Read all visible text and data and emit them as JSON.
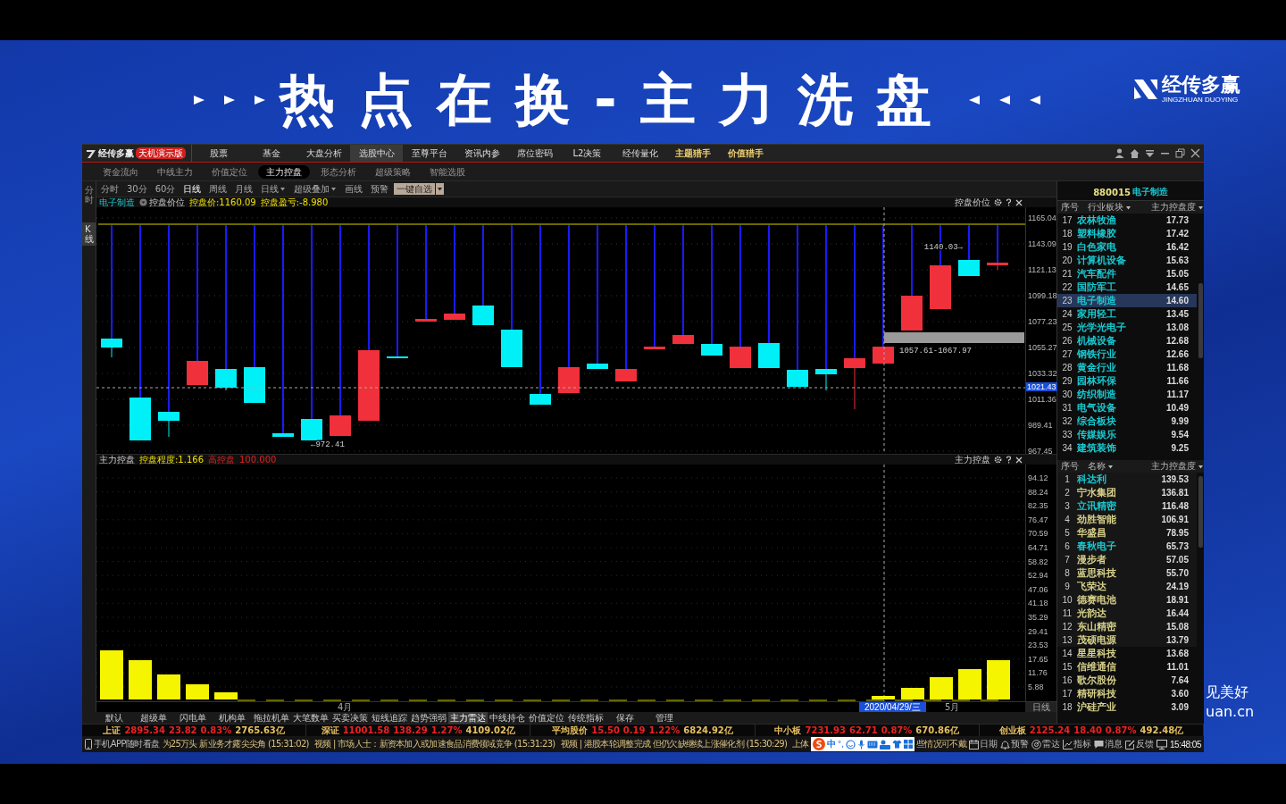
{
  "banner": {
    "title": "热点在换-主力洗盘",
    "logo": {
      "name": "经传多赢",
      "subtitle": "JINGZHUAN DUOYING"
    }
  },
  "backdrop_text": [
    "见美好",
    "uan.cn"
  ],
  "window": {
    "app_name": "经传多赢",
    "edition": "天机演示版",
    "menu": [
      {
        "label": "股票",
        "selected": false,
        "highlighted": false
      },
      {
        "label": "基金",
        "selected": false,
        "highlighted": false
      },
      {
        "label": "大盘分析",
        "selected": false,
        "highlighted": false
      },
      {
        "label": "选股中心",
        "selected": true,
        "highlighted": false
      },
      {
        "label": "至尊平台",
        "selected": false,
        "highlighted": false
      },
      {
        "label": "资讯内参",
        "selected": false,
        "highlighted": false
      },
      {
        "label": "席位密码",
        "selected": false,
        "highlighted": false
      },
      {
        "label": "L2决策",
        "selected": false,
        "highlighted": false
      },
      {
        "label": "经传量化",
        "selected": false,
        "highlighted": false
      },
      {
        "label": "主题猎手",
        "selected": false,
        "highlighted": true
      },
      {
        "label": "价值猎手",
        "selected": false,
        "highlighted": true
      }
    ]
  },
  "subtabs": [
    {
      "label": "资金流向",
      "selected": false
    },
    {
      "label": "中线主力",
      "selected": false
    },
    {
      "label": "价值定位",
      "selected": false
    },
    {
      "label": "主力控盘",
      "selected": true
    },
    {
      "label": "形态分析",
      "selected": false
    },
    {
      "label": "超级策略",
      "selected": false
    },
    {
      "label": "智能选股",
      "selected": false
    }
  ],
  "side_tabs": [
    {
      "label": "分时",
      "selected": false
    },
    {
      "label": "K线",
      "selected": true
    }
  ],
  "toolbar": [
    {
      "kind": "tab",
      "label": "分时",
      "selected": false
    },
    {
      "kind": "tab",
      "label": "30分",
      "selected": false
    },
    {
      "kind": "tab",
      "label": "60分",
      "selected": false
    },
    {
      "kind": "tab",
      "label": "日线",
      "selected": true
    },
    {
      "kind": "tab",
      "label": "周线",
      "selected": false
    },
    {
      "kind": "tab",
      "label": "月线",
      "selected": false
    },
    {
      "kind": "dropdown",
      "label": "日线"
    },
    {
      "kind": "dropdown",
      "label": "超级叠加"
    },
    {
      "kind": "button",
      "label": "画线"
    },
    {
      "kind": "button",
      "label": "预警"
    },
    {
      "kind": "split",
      "label": "一键自选"
    }
  ],
  "upper_panel": {
    "name": "电子制造",
    "toggle": "控盘价位",
    "price": "控盘价:1160.09",
    "pnl": "控盘盈亏:-8.980",
    "title": "控盘价位",
    "y_labels": [
      "1165.04",
      "1143.09",
      "1121.13",
      "1099.18",
      "1077.23",
      "1055.27",
      "1033.32",
      "1011.36",
      "989.41",
      "967.45"
    ],
    "current": "1021.43",
    "annotations": [
      "1140.03→",
      "←972.41",
      "1057.61-1067.97"
    ]
  },
  "lower_panel": {
    "name": "主力控盘",
    "degree": "控盘程度:1.166",
    "high_label": "高控盘",
    "high_value": "100.000",
    "title": "主力控盘",
    "y_labels": [
      "94.12",
      "88.24",
      "82.35",
      "76.47",
      "70.59",
      "64.71",
      "58.82",
      "52.94",
      "47.06",
      "41.18",
      "35.29",
      "29.41",
      "23.53",
      "17.65",
      "11.76",
      "5.88"
    ]
  },
  "date_axis": {
    "labels": [
      "4月",
      "5月"
    ],
    "cursor_date": "2020/04/29/三",
    "period": "日线"
  },
  "bottom_tabs": [
    {
      "label": "默认",
      "selected": false
    },
    {
      "label": "超级单",
      "selected": false
    },
    {
      "label": "闪电单",
      "selected": false
    },
    {
      "label": "机构单",
      "selected": false
    },
    {
      "label": "拖拉机单",
      "selected": false
    },
    {
      "label": "大笔数单",
      "selected": false
    },
    {
      "label": "买卖决策",
      "selected": false
    },
    {
      "label": "短线追踪",
      "selected": false
    },
    {
      "label": "趋势强弱",
      "selected": false
    },
    {
      "label": "主力雷达",
      "selected": true
    },
    {
      "label": "中线持仓",
      "selected": false
    },
    {
      "label": "价值定位",
      "selected": false
    },
    {
      "label": "传统指标",
      "selected": false
    },
    {
      "label": "保存",
      "selected": false
    },
    {
      "label": "管理",
      "selected": false
    }
  ],
  "right_panel": {
    "code": "880015",
    "name": "电子制造",
    "sector_columns": [
      "序号",
      "行业板块",
      "主力控盘度"
    ],
    "sectors": [
      {
        "no": "17",
        "name": "农林牧渔",
        "value": "17.73",
        "selected": false
      },
      {
        "no": "18",
        "name": "塑料橡胶",
        "value": "17.42",
        "selected": false
      },
      {
        "no": "19",
        "name": "白色家电",
        "value": "16.42",
        "selected": false
      },
      {
        "no": "20",
        "name": "计算机设备",
        "value": "15.63",
        "selected": false
      },
      {
        "no": "21",
        "name": "汽车配件",
        "value": "15.05",
        "selected": false
      },
      {
        "no": "22",
        "name": "国防军工",
        "value": "14.65",
        "selected": false
      },
      {
        "no": "23",
        "name": "电子制造",
        "value": "14.60",
        "selected": true
      },
      {
        "no": "24",
        "name": "家用轻工",
        "value": "13.45",
        "selected": false
      },
      {
        "no": "25",
        "name": "光学光电子",
        "value": "13.08",
        "selected": false
      },
      {
        "no": "26",
        "name": "机械设备",
        "value": "12.68",
        "selected": false
      },
      {
        "no": "27",
        "name": "钢铁行业",
        "value": "12.66",
        "selected": false
      },
      {
        "no": "28",
        "name": "黄金行业",
        "value": "11.68",
        "selected": false
      },
      {
        "no": "29",
        "name": "园林环保",
        "value": "11.66",
        "selected": false
      },
      {
        "no": "30",
        "name": "纺织制造",
        "value": "11.17",
        "selected": false
      },
      {
        "no": "31",
        "name": "电气设备",
        "value": "10.49",
        "selected": false
      },
      {
        "no": "32",
        "name": "综合板块",
        "value": "9.99",
        "selected": false
      },
      {
        "no": "33",
        "name": "传媒娱乐",
        "value": "9.54",
        "selected": false
      },
      {
        "no": "34",
        "name": "建筑装饰",
        "value": "9.25",
        "selected": false
      }
    ],
    "stock_columns": [
      "序号",
      "名称",
      "主力控盘度"
    ],
    "stocks": [
      {
        "no": "1",
        "name": "科达利",
        "value": "139.53",
        "color": "#19c8d0"
      },
      {
        "no": "2",
        "name": "宁水集团",
        "value": "136.81",
        "color": "#d6d08a"
      },
      {
        "no": "3",
        "name": "立讯精密",
        "value": "116.48",
        "color": "#19c8d0"
      },
      {
        "no": "4",
        "name": "劲胜智能",
        "value": "106.91",
        "color": "#d6d08a"
      },
      {
        "no": "5",
        "name": "华盛昌",
        "value": "78.95",
        "color": "#d6d08a"
      },
      {
        "no": "6",
        "name": "春秋电子",
        "value": "65.73",
        "color": "#19c8d0"
      },
      {
        "no": "7",
        "name": "漫步者",
        "value": "57.05",
        "color": "#d6d08a"
      },
      {
        "no": "8",
        "name": "蓝思科技",
        "value": "55.70",
        "color": "#d6d08a"
      },
      {
        "no": "9",
        "name": "飞荣达",
        "value": "24.19",
        "color": "#d6d08a"
      },
      {
        "no": "10",
        "name": "德赛电池",
        "value": "18.91",
        "color": "#d6d08a"
      },
      {
        "no": "11",
        "name": "光韵达",
        "value": "16.44",
        "color": "#d6d08a"
      },
      {
        "no": "12",
        "name": "东山精密",
        "value": "15.08",
        "color": "#d6d08a"
      },
      {
        "no": "13",
        "name": "茂硕电源",
        "value": "13.79",
        "color": "#d6d08a"
      },
      {
        "no": "14",
        "name": "星星科技",
        "value": "13.68",
        "color": "#d6d08a"
      },
      {
        "no": "15",
        "name": "信维通信",
        "value": "11.01",
        "color": "#d6d08a"
      },
      {
        "no": "16",
        "name": "歌尔股份",
        "value": "7.64",
        "color": "#d6d08a"
      },
      {
        "no": "17",
        "name": "精研科技",
        "value": "3.60",
        "color": "#d6d08a"
      },
      {
        "no": "18",
        "name": "沪硅产业",
        "value": "3.09",
        "color": "#d6d08a"
      }
    ]
  },
  "index_bar": [
    {
      "name": "上证",
      "price": "2895.34",
      "change": "23.82",
      "pct": "0.83%",
      "amount": "2765.63亿"
    },
    {
      "name": "深证",
      "price": "11001.58",
      "change": "138.29",
      "pct": "1.27%",
      "amount": "4109.02亿"
    },
    {
      "name": "平均股价",
      "price": "15.50",
      "change": "0.19",
      "pct": "1.22%",
      "amount": "6824.92亿"
    },
    {
      "name": "中小板",
      "price": "7231.93",
      "change": "62.71",
      "pct": "0.87%",
      "amount": "670.86亿"
    },
    {
      "name": "创业板",
      "price": "2125.24",
      "change": "18.40",
      "pct": "0.87%",
      "amount": "492.48亿"
    }
  ],
  "news_bar": {
    "app_label": "手机APP随时看盘",
    "news": [
      "为25万头 新业务才露尖尖角 (15:31:02)",
      "视频 | 市场人士：新资本加入或加速食品消费领域竞争 (15:31:23)",
      "视频 | 港股本轮调整完成 但仍欠缺继续上涨催化剂 (15:30:29)",
      "上体"
    ],
    "news_tail": "些情况可不戴",
    "ime": {
      "mode": "中",
      "punct": "°,"
    },
    "tools": [
      "日期",
      "预警",
      "雷达",
      "指标",
      "消息",
      "反馈"
    ],
    "clock": "15:48:05"
  }
}
